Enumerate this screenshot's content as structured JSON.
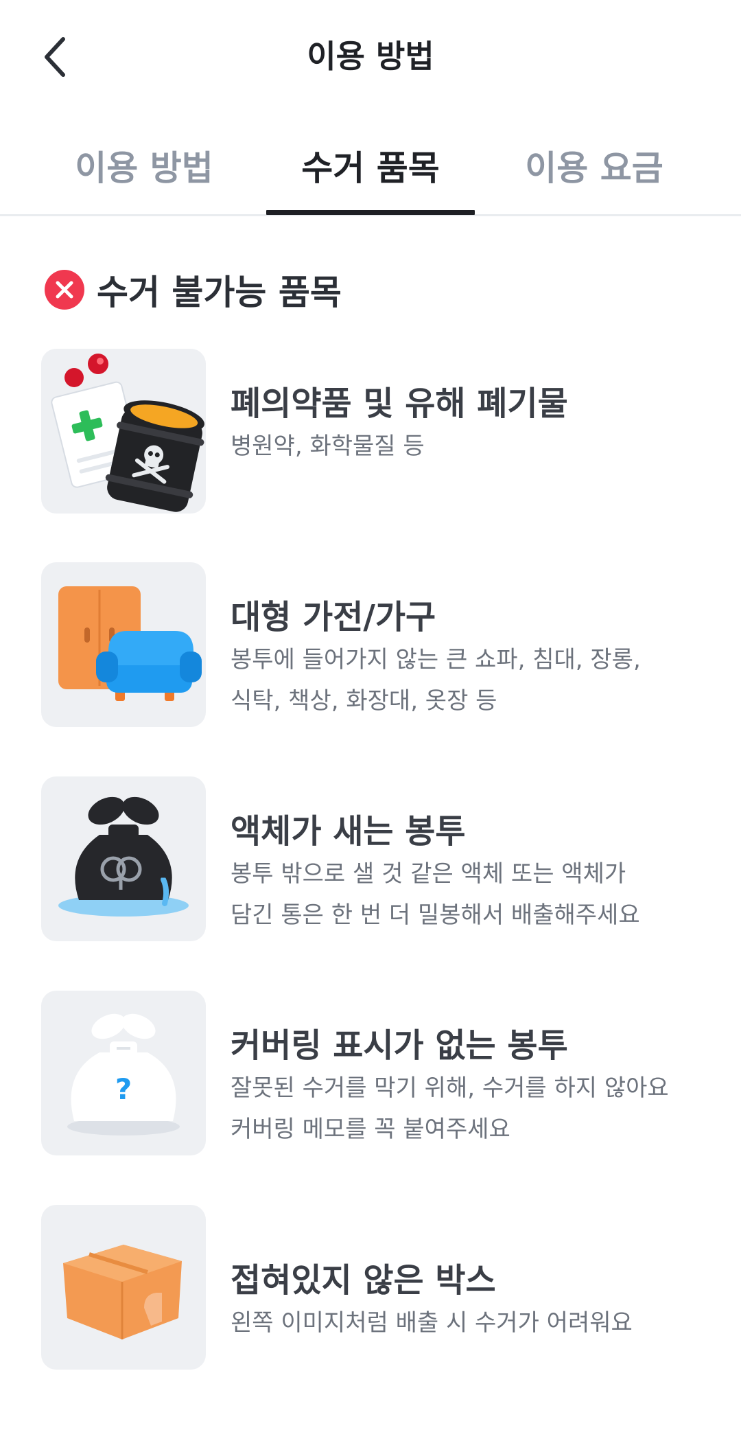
{
  "header": {
    "title": "이용 방법",
    "back_icon": "chevron-left-icon"
  },
  "tabs": [
    {
      "label": "이용 방법",
      "active": false
    },
    {
      "label": "수거 품목",
      "active": true
    },
    {
      "label": "이용 요금",
      "active": false
    }
  ],
  "section": {
    "title": "수거 불가능 품목",
    "icon": "x-circle-icon",
    "icon_color": "#f0384f"
  },
  "items": [
    {
      "title": "폐의약품 및 유해 폐기물",
      "desc_line1": "병원약, 화학물질 등",
      "desc_line2": "",
      "icon": "hazardous-waste-icon"
    },
    {
      "title": "대형 가전/가구",
      "desc_line1": "봉투에 들어가지 않는 큰 쇼파, 침대, 장롱,",
      "desc_line2": "식탁, 책상, 화장대, 옷장 등",
      "icon": "furniture-icon"
    },
    {
      "title": "액체가 새는 봉투",
      "desc_line1": "봉투 밖으로 샐 것 같은 액체 또는 액체가",
      "desc_line2": "담긴 통은 한 번 더 밀봉해서 배출해주세요",
      "icon": "leaking-bag-icon"
    },
    {
      "title": "커버링 표시가 없는 봉투",
      "desc_line1": "잘못된 수거를 막기 위해, 수거를 하지 않아요",
      "desc_line2": "커버링 메모를 꼭 붙여주세요",
      "icon": "unmarked-bag-icon"
    },
    {
      "title": "접혀있지 않은 박스",
      "desc_line1": "왼쪽 이미지처럼 배출 시 수거가 어려워요",
      "desc_line2": "",
      "icon": "unfolded-box-icon"
    }
  ]
}
